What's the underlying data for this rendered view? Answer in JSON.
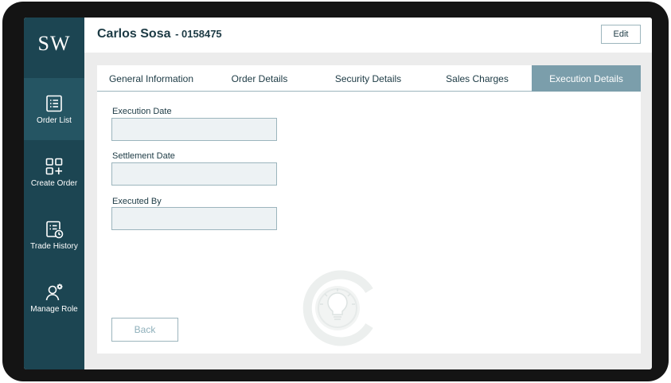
{
  "app": {
    "logo_text": "SW",
    "accent_color": "#1c4552",
    "active_tab_color": "#7b9eab"
  },
  "sidebar": {
    "items": [
      {
        "label": "Order List",
        "icon": "list-document-icon",
        "active": true
      },
      {
        "label": "Create Order",
        "icon": "grid-add-icon",
        "active": false
      },
      {
        "label": "Trade History",
        "icon": "document-clock-icon",
        "active": false
      },
      {
        "label": "Manage Role",
        "icon": "user-gear-icon",
        "active": false
      }
    ]
  },
  "header": {
    "name": "Carlos Sosa",
    "separator": " - ",
    "order_id": "0158475",
    "edit_label": "Edit"
  },
  "tabs": [
    {
      "label": "General Information",
      "active": false
    },
    {
      "label": "Order Details",
      "active": false
    },
    {
      "label": "Security Details",
      "active": false
    },
    {
      "label": "Sales Charges",
      "active": false
    },
    {
      "label": "Execution Details",
      "active": true
    }
  ],
  "form": {
    "fields": [
      {
        "label": "Execution Date",
        "value": ""
      },
      {
        "label": "Settlement Date",
        "value": ""
      },
      {
        "label": "Executed By",
        "value": ""
      }
    ],
    "back_label": "Back"
  },
  "watermark": {
    "icon": "lightbulb-c-watermark-icon"
  }
}
